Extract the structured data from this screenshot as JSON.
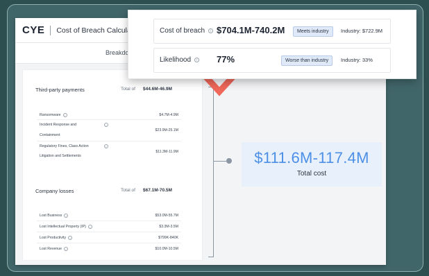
{
  "app": {
    "logo": "CYE",
    "title": "Cost of Breach Calculator",
    "subnav_label": "Breakdo"
  },
  "summary": {
    "cost_of_breach": {
      "label": "Cost of breach",
      "value": "$704.1M-740.2M",
      "status": "Meets industry",
      "industry": "Industry: $722.9M"
    },
    "likelihood": {
      "label": "Likelihood",
      "value": "77%",
      "status": "Worse than industry",
      "industry": "Industry: 33%"
    }
  },
  "third_party": {
    "title": "Third-party payments",
    "total_label": "Total of",
    "total_value": "$44.6M-46.9M",
    "rows": [
      {
        "label": "Ransomware",
        "value": "$4.7M-4.9M"
      },
      {
        "label": "Incident Response and",
        "label2": "Containment",
        "value": "$23.9M-25.1M"
      },
      {
        "label": "Regulatory Fines, Class Action",
        "label2": "Litigation and Settlements",
        "value": "$11.3M-11.9M"
      }
    ]
  },
  "company_losses": {
    "title": "Company losses",
    "total_label": "Total of",
    "total_value": "$67.1M-70.5M",
    "rows": [
      {
        "label": "Lost Business",
        "value": "$53.0M-55.7M"
      },
      {
        "label": "Lost Intellectual Property (IP)",
        "value": "$3.3M-3.5M"
      },
      {
        "label": "Lost Productivity",
        "value": "$799K-840K"
      },
      {
        "label": "Lost Revenue",
        "value": "$10.0M-10.5M"
      }
    ]
  },
  "total": {
    "value": "$111.6M-117.4M",
    "label": "Total cost"
  },
  "icons": {
    "info": "i",
    "info_icon": "info-icon",
    "chevron": "chevron-down-icon"
  },
  "colors": {
    "accent_blue": "#4c8fe6",
    "chevron_red": "#f0685a",
    "badge_bg": "#dfe9f8",
    "background": "#2e4f50"
  }
}
